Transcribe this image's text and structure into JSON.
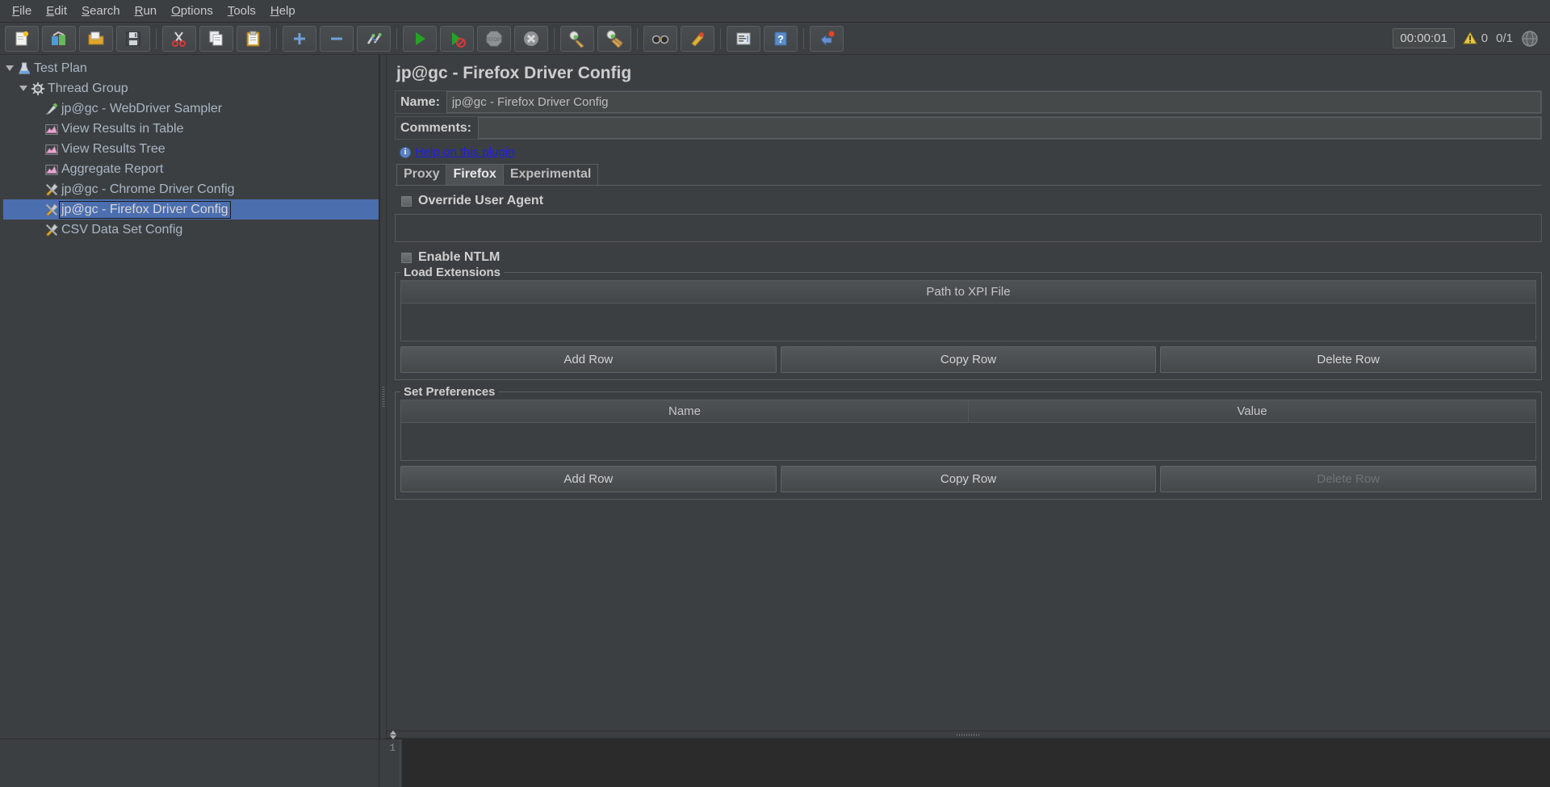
{
  "menu": {
    "items": [
      {
        "label": "File",
        "mnemonic": "F"
      },
      {
        "label": "Edit",
        "mnemonic": "E"
      },
      {
        "label": "Search",
        "mnemonic": "S"
      },
      {
        "label": "Run",
        "mnemonic": "R"
      },
      {
        "label": "Options",
        "mnemonic": "O"
      },
      {
        "label": "Tools",
        "mnemonic": "T"
      },
      {
        "label": "Help",
        "mnemonic": "H"
      }
    ]
  },
  "toolbar": {
    "buttons": [
      {
        "name": "new-icon",
        "title": "New"
      },
      {
        "name": "templates-icon",
        "title": "Templates"
      },
      {
        "name": "open-icon",
        "title": "Open"
      },
      {
        "name": "save-icon",
        "title": "Save Test Plan"
      },
      {
        "name": "cut-icon",
        "title": "Cut"
      },
      {
        "name": "copy-icon",
        "title": "Copy"
      },
      {
        "name": "paste-icon",
        "title": "Paste"
      },
      {
        "name": "expand-all-icon",
        "title": "Expand All"
      },
      {
        "name": "collapse-all-icon",
        "title": "Collapse All"
      },
      {
        "name": "toggle-icon",
        "title": "Toggle"
      },
      {
        "name": "start-icon",
        "title": "Start"
      },
      {
        "name": "start-no-timers-icon",
        "title": "Start no pauses"
      },
      {
        "name": "stop-icon",
        "title": "Stop"
      },
      {
        "name": "shutdown-icon",
        "title": "Shutdown"
      },
      {
        "name": "clear-icon",
        "title": "Clear"
      },
      {
        "name": "clear-all-icon",
        "title": "Clear All"
      },
      {
        "name": "search-icon",
        "title": "Search"
      },
      {
        "name": "reset-search-icon",
        "title": "Reset Search"
      },
      {
        "name": "function-helper-icon",
        "title": "Function Helper Dialog"
      },
      {
        "name": "help-icon",
        "title": "Help"
      },
      {
        "name": "undo-icon",
        "title": "Undo"
      }
    ],
    "timer": "00:00:01",
    "warning_count": "0",
    "threads_status": "0/1"
  },
  "tree": {
    "nodes": [
      {
        "label": "Test Plan",
        "icon": "test-plan-icon",
        "depth": 0,
        "expandable": true,
        "selected": false
      },
      {
        "label": "Thread Group",
        "icon": "thread-group-icon",
        "depth": 1,
        "expandable": true,
        "selected": false
      },
      {
        "label": "jp@gc - WebDriver Sampler",
        "icon": "sampler-icon",
        "depth": 2,
        "expandable": false,
        "selected": false
      },
      {
        "label": "View Results in Table",
        "icon": "listener-icon",
        "depth": 2,
        "expandable": false,
        "selected": false
      },
      {
        "label": "View Results Tree",
        "icon": "listener-icon",
        "depth": 2,
        "expandable": false,
        "selected": false
      },
      {
        "label": "Aggregate Report",
        "icon": "listener-icon",
        "depth": 2,
        "expandable": false,
        "selected": false
      },
      {
        "label": "jp@gc - Chrome Driver Config",
        "icon": "config-icon",
        "depth": 2,
        "expandable": false,
        "selected": false
      },
      {
        "label": "jp@gc - Firefox Driver Config",
        "icon": "config-icon",
        "depth": 2,
        "expandable": false,
        "selected": true
      },
      {
        "label": "CSV Data Set Config",
        "icon": "config-icon",
        "depth": 2,
        "expandable": false,
        "selected": false
      }
    ]
  },
  "panel": {
    "title": "jp@gc - Firefox Driver Config",
    "name_label": "Name:",
    "name_value": "jp@gc - Firefox Driver Config",
    "comments_label": "Comments:",
    "comments_value": "",
    "help_link": "Help on this plugin",
    "tabs": [
      {
        "label": "Proxy",
        "active": false
      },
      {
        "label": "Firefox",
        "active": true
      },
      {
        "label": "Experimental",
        "active": false
      }
    ],
    "firefox": {
      "override_user_agent_label": "Override User Agent",
      "override_user_agent_checked": false,
      "user_agent_value": "",
      "enable_ntlm_label": "Enable NTLM",
      "enable_ntlm_checked": false,
      "load_extensions": {
        "title": "Load Extensions",
        "columns": [
          "Path to XPI File"
        ],
        "rows": [],
        "buttons": [
          {
            "label": "Add Row",
            "disabled": false
          },
          {
            "label": "Copy Row",
            "disabled": false
          },
          {
            "label": "Delete Row",
            "disabled": false
          }
        ]
      },
      "set_preferences": {
        "title": "Set Preferences",
        "columns": [
          "Name",
          "Value"
        ],
        "rows": [],
        "buttons": [
          {
            "label": "Add Row",
            "disabled": false
          },
          {
            "label": "Copy Row",
            "disabled": false
          },
          {
            "label": "Delete Row",
            "disabled": true
          }
        ]
      }
    }
  },
  "log": {
    "line_number": "1",
    "content": ""
  }
}
